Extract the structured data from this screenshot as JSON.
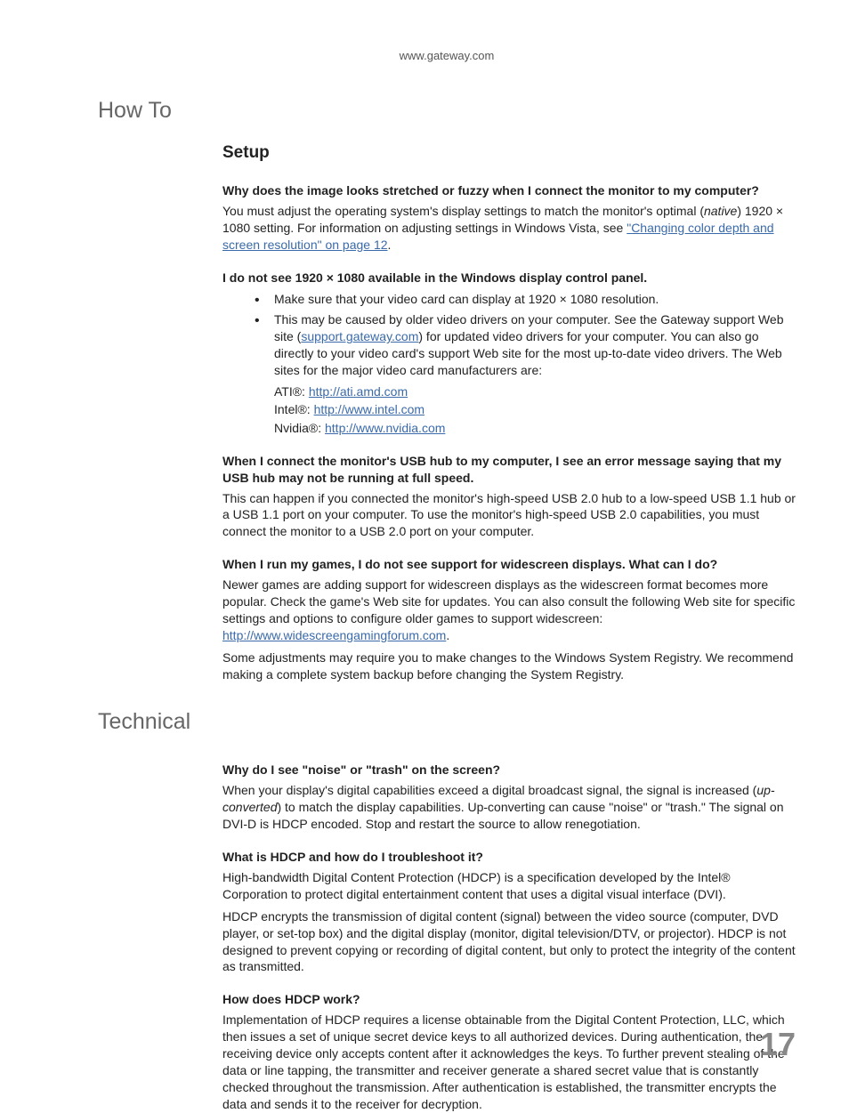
{
  "header": {
    "url": "www.gateway.com"
  },
  "sections": {
    "howto": {
      "title": "How To",
      "subtitle": "Setup",
      "q1": "Why does the image looks stretched or fuzzy when I connect the monitor to my computer?",
      "a1_pre": "You must adjust the operating system's display settings to match the monitor's optimal (",
      "a1_italic": "native",
      "a1_mid": ") 1920 × 1080 setting. For information on adjusting settings in Windows Vista, see ",
      "a1_link": "\"Changing color depth and screen resolution\" on page 12",
      "a1_post": ".",
      "q2": "I do not see 1920 × 1080 available in the Windows display control panel.",
      "b1": "Make sure that your video card can display at 1920 × 1080 resolution.",
      "b2_pre": "This may be caused by older video drivers on your computer. See the Gateway support Web site (",
      "b2_link": "support.gateway.com",
      "b2_post": ") for updated video drivers for your computer. You can also go directly to your video card's support Web site for the most up-to-date video drivers. The Web sites for the major video card manufacturers are:",
      "ati_label": "ATI®: ",
      "ati_link": "http://ati.amd.com",
      "intel_label": "Intel®: ",
      "intel_link": "http://www.intel.com",
      "nvidia_label": "Nvidia®: ",
      "nvidia_link": "http://www.nvidia.com",
      "q3": "When I connect the monitor's USB hub to my computer, I see an error message saying that my USB hub may not be running at full speed.",
      "a3": "This can happen if you connected the monitor's high-speed USB 2.0 hub to a low-speed USB 1.1 hub or a USB 1.1 port on your computer. To use the monitor's high-speed USB 2.0 capabilities, you must connect the monitor to a USB 2.0 port on your computer.",
      "q4": "When I run my games, I do not see support for widescreen displays. What can I do?",
      "a4a": "Newer games are adding support for widescreen displays as the widescreen format becomes more popular. Check the game's Web site for updates. You can also consult the following Web site for specific settings and options to configure older games to support widescreen:",
      "a4_link": "http://www.widescreengamingforum.com",
      "a4_post": ".",
      "a4b": "Some adjustments may require you to make changes to the Windows System Registry. We recommend making a complete system backup before changing the System Registry."
    },
    "technical": {
      "title": "Technical",
      "q1": "Why do I see \"noise\" or \"trash\" on the screen?",
      "a1_pre": "When your display's digital capabilities exceed a digital broadcast signal, the signal is increased (",
      "a1_italic": "up-converted",
      "a1_post": ") to match the display capabilities. Up-converting can cause \"noise\" or \"trash.\" The signal on DVI-D is HDCP encoded. Stop and restart the source to allow renegotiation.",
      "q2": "What is HDCP and how do I troubleshoot it?",
      "a2a": "High-bandwidth Digital Content Protection (HDCP) is a specification developed by the Intel® Corporation to protect digital entertainment content that uses a digital visual interface (DVI).",
      "a2b": "HDCP encrypts the transmission of digital content (signal) between the video source (computer, DVD player, or set-top box) and the digital display (monitor, digital television/DTV, or projector). HDCP is not designed to prevent copying or recording of digital content, but only to protect the integrity of the content as transmitted.",
      "q3": "How does HDCP work?",
      "a3": "Implementation of HDCP requires a license obtainable from the Digital Content Protection, LLC, which then issues a set of unique secret device keys to all authorized devices. During authentication, the receiving device only accepts content after it acknowledges the keys. To further prevent stealing of the data or line tapping, the transmitter and receiver generate a shared secret value that is constantly checked throughout the transmission. After authentication is established, the transmitter encrypts the data and sends it to the receiver for decryption."
    }
  },
  "page_number": "17"
}
